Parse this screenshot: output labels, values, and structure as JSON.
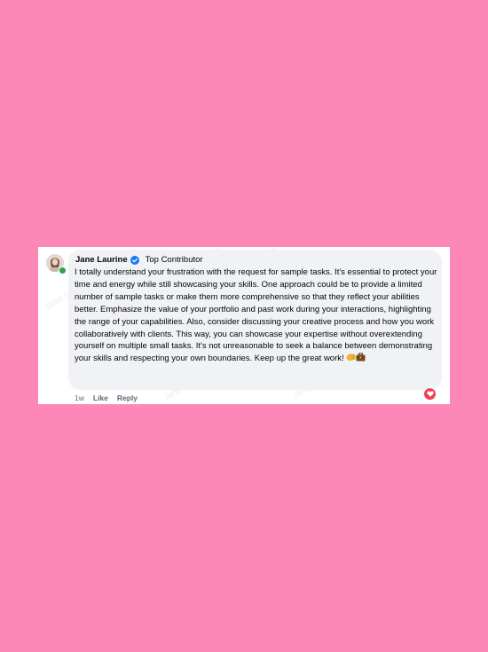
{
  "comment": {
    "author": "Jane Laurine",
    "badge": "Top Contributor",
    "text": "I totally understand your frustration with the request for sample tasks. It's essential to protect your time and energy while still showcasing your skills. One approach could be to provide a limited number of sample tasks or make them more comprehensive so that they reflect your abilities better. Emphasize the value of your portfolio and past work during your interactions, highlighting the range of your capabilities. Also, consider discussing your creative process and how you work collaboratively with clients. This way, you can showcase your expertise without overextending yourself on multiple small tasks. It's not unreasonable to seek a balance between demonstrating your skills and respecting your own boundaries. Keep up the great work!",
    "emojis": [
      "hand-icon",
      "briefcase-icon"
    ],
    "timestamp": "1w",
    "like_label": "Like",
    "reply_label": "Reply",
    "reaction": "heart-icon"
  },
  "watermark": "jane laurine",
  "colors": {
    "background": "#fd88b8",
    "bubble": "#f0f2f5",
    "verified": "#1877f2",
    "reaction": "#f33e58"
  }
}
